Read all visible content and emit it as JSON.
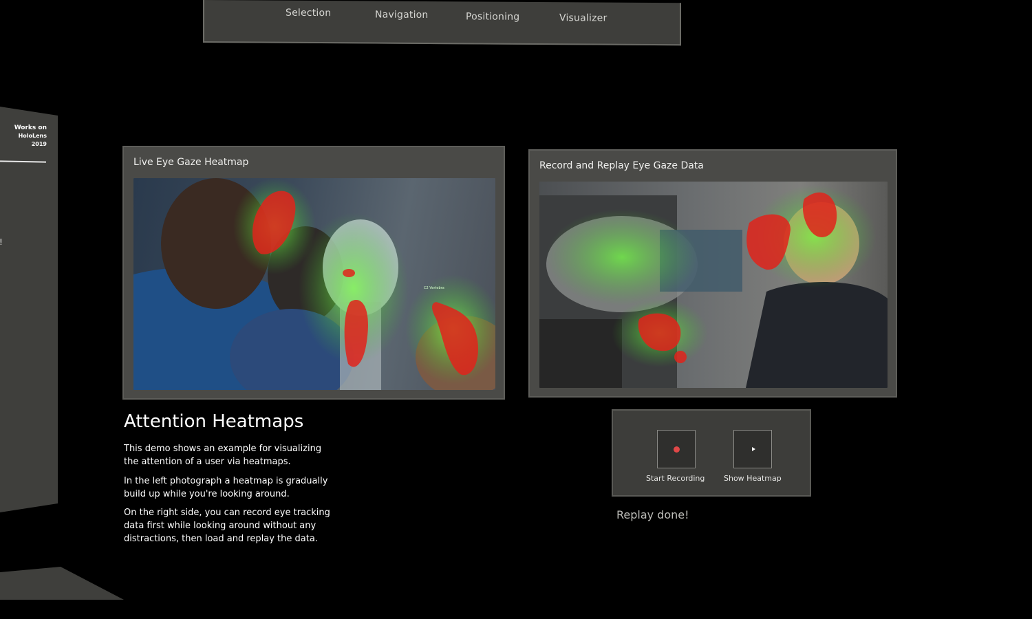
{
  "top_menu": {
    "tabs": [
      {
        "label": "Selection"
      },
      {
        "label": "Navigation"
      },
      {
        "label": "Positioning"
      },
      {
        "label": "Visualizer"
      }
    ]
  },
  "left_panel": {
    "works_on_line1": "Works on",
    "works_on_line2": "HoloLens 2019",
    "partial_text": "!"
  },
  "live_card": {
    "title": "Live Eye Gaze Heatmap",
    "photo_label": "C2 Vertebra"
  },
  "replay_card": {
    "title": "Record and Replay Eye Gaze Data"
  },
  "description": {
    "heading": "Attention Heatmaps",
    "paragraphs": [
      "This demo shows an example for visualizing the attention of a user via heatmaps.",
      "In the left photograph a heatmap is gradually build up while you're looking around.",
      "On the right side, you can record eye tracking data first while looking around without any distractions, then load and replay the data."
    ]
  },
  "controls": {
    "record_label": "Start Recording",
    "record_icon": "record-dot-icon",
    "show_label": "Show Heatmap",
    "show_icon": "play-icon",
    "accent_color": "#e04848"
  },
  "status_text": "Replay done!"
}
